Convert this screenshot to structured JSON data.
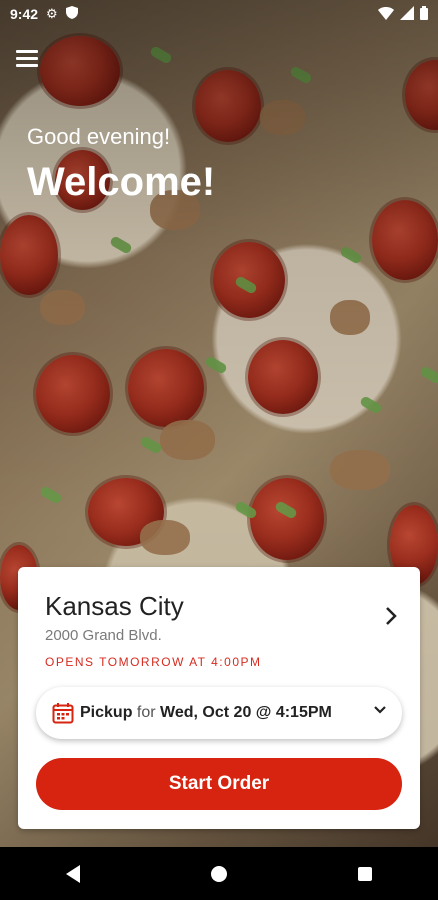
{
  "status": {
    "time": "9:42"
  },
  "header": {
    "greeting": "Good evening!",
    "welcome": "Welcome!"
  },
  "location": {
    "name": "Kansas City",
    "address": "2000 Grand Blvd.",
    "hours_note": "OPENS TOMORROW AT 4:00PM"
  },
  "pickup": {
    "mode": "Pickup",
    "connector": "for",
    "time": "Wed, Oct 20 @ 4:15PM"
  },
  "cta": {
    "start_order": "Start Order"
  },
  "colors": {
    "accent": "#d62410",
    "alert_text": "#d62b1f"
  },
  "icons": [
    "settings-icon",
    "shield-icon",
    "wifi-icon",
    "signal-icon",
    "battery-icon",
    "menu-icon",
    "chevron-right-icon",
    "calendar-icon",
    "chevron-down-icon"
  ]
}
